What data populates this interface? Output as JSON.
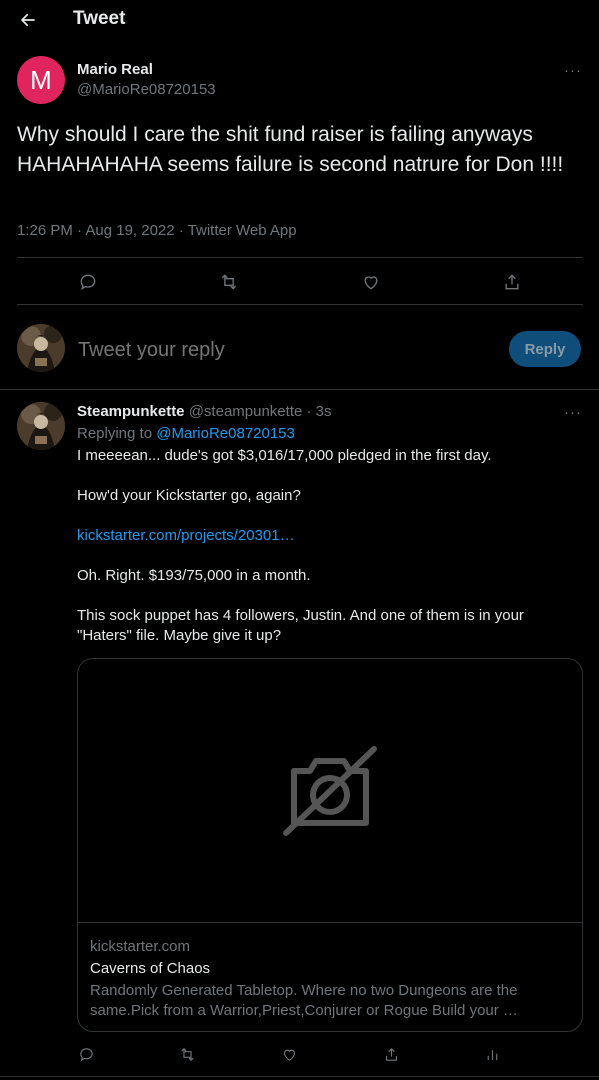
{
  "header": {
    "title": "Tweet",
    "back_icon": "arrow-left-icon"
  },
  "tweet": {
    "avatar_letter": "M",
    "avatar_color": "#e0245e",
    "author_name": "Mario Real",
    "author_handle": "@MarioRe08720153",
    "more_label": "···",
    "text": "Why should I care the shit fund raiser is failing anyways HAHAHAHAHA seems failure is second natrure for Don !!!!",
    "meta": "1:26 PM · Aug 19, 2022 · Twitter Web App",
    "actions": [
      "reply-icon",
      "retweet-icon",
      "like-icon",
      "share-icon"
    ]
  },
  "composer": {
    "placeholder": "Tweet your reply",
    "reply_button": "Reply"
  },
  "reply": {
    "author_name": "Steampunkette",
    "author_handle": "@steampunkette",
    "dot": "·",
    "time": "3s",
    "more_label": "···",
    "replying_prefix": "Replying to",
    "replying_mention": "@MarioRe08720153",
    "lines": [
      "I meeeean... dude's got $3,016/17,000 pledged in the first day.",
      "How'd your Kickstarter go, again?",
      "kickstarter.com/projects/20301…",
      "Oh. Right. $193/75,000 in a month.",
      "This sock puppet has 4 followers, Justin. And one of them is in your",
      "\"Haters\" file. Maybe give it up?"
    ],
    "card": {
      "media_icon": "image-unavailable-icon",
      "domain": "kickstarter.com",
      "title": "Caverns of Chaos",
      "description": "Randomly Generated Tabletop. Where no two Dungeons are the same.Pick from a Warrior,Priest,Conjurer or Rogue Build your …"
    },
    "actions": [
      "reply-icon",
      "retweet-icon",
      "like-icon",
      "share-icon",
      "analytics-icon"
    ]
  },
  "colors": {
    "accent": "#1d9bf0",
    "background": "#000000",
    "border": "#2f3336",
    "muted_text": "#71767b",
    "reply_button_bg": "#0f4e7a"
  }
}
